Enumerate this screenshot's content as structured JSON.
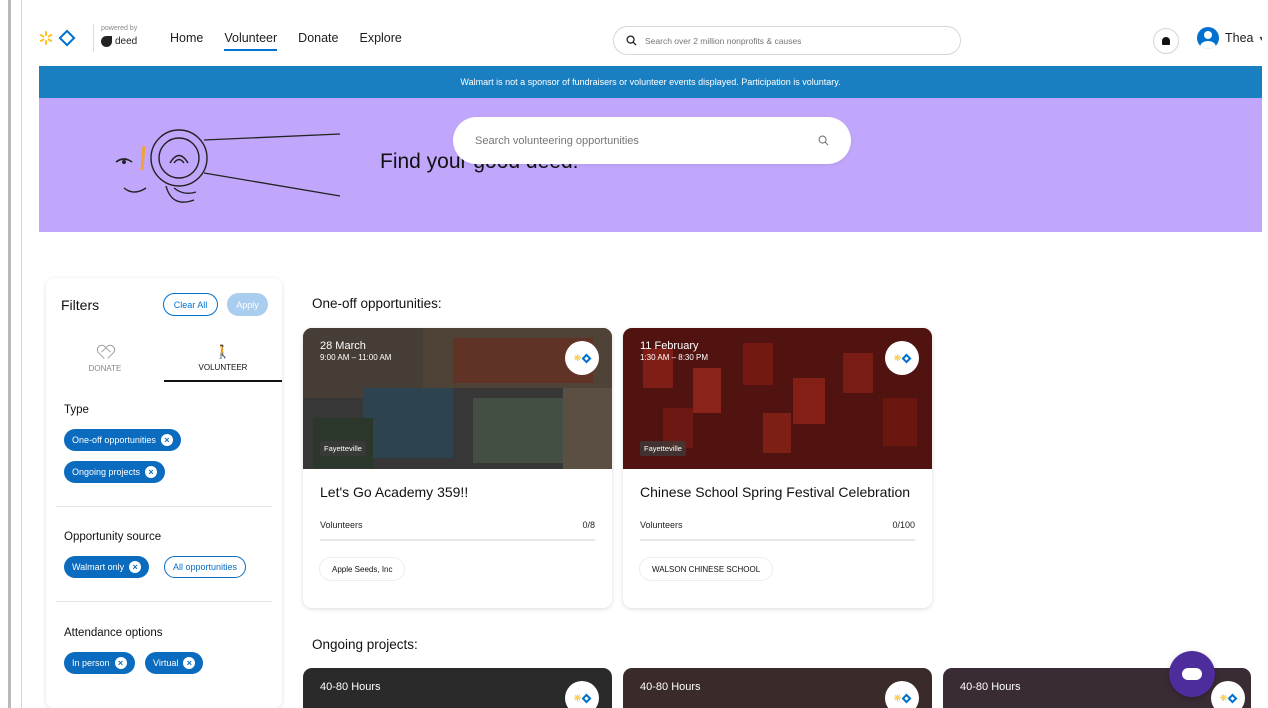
{
  "brand": {
    "powered_by": "powered by",
    "deed_name": "deed"
  },
  "nav": {
    "links": [
      {
        "label": "Home",
        "active": false
      },
      {
        "label": "Volunteer",
        "active": true
      },
      {
        "label": "Donate",
        "active": false
      },
      {
        "label": "Explore",
        "active": false
      }
    ]
  },
  "top_search": {
    "placeholder": "Search over 2 million nonprofits & causes"
  },
  "user": {
    "name": "Thea"
  },
  "banner": {
    "text": "Walmart is not a sponsor of fundraisers or volunteer events displayed. Participation is voluntary."
  },
  "hero": {
    "title": "Find your good deed!",
    "search_placeholder": "Search volunteering opportunities"
  },
  "filters": {
    "title": "Filters",
    "clear_label": "Clear All",
    "apply_label": "Apply",
    "tabs": [
      {
        "label": "DONATE"
      },
      {
        "label": "VOLUNTEER"
      }
    ],
    "type": {
      "label": "Type",
      "chips": [
        "One-off opportunities",
        "Ongoing projects"
      ]
    },
    "source": {
      "label": "Opportunity source",
      "chips": [
        "Walmart only",
        "All opportunities"
      ]
    },
    "attendance": {
      "label": "Attendance options",
      "chips": [
        "In person",
        "Virtual"
      ]
    }
  },
  "sections": {
    "one_off": "One-off opportunities:",
    "ongoing": "Ongoing projects:"
  },
  "one_off_cards": [
    {
      "date": "28 March",
      "time": "9:00 AM – 11:00 AM",
      "location": "Fayetteville",
      "title": "Let's Go Academy 359!!",
      "volunteers_label": "Volunteers",
      "volunteers": "0/8",
      "org": "Apple Seeds, Inc"
    },
    {
      "date": "11 February",
      "time": "1:30 AM – 8:30 PM",
      "location": "Fayetteville",
      "title": "Chinese School Spring Festival Celebration",
      "volunteers_label": "Volunteers",
      "volunteers": "0/100",
      "org": "WALSON CHINESE SCHOOL"
    }
  ],
  "ongoing_cards": [
    {
      "hours": "40-80 Hours"
    },
    {
      "hours": "40-80 Hours"
    },
    {
      "hours": "40-80 Hours"
    }
  ],
  "colors": {
    "accent": "#0071ce",
    "banner": "#1a7fc1",
    "hero": "#c1a7fb",
    "chat": "#4d2c9c"
  }
}
